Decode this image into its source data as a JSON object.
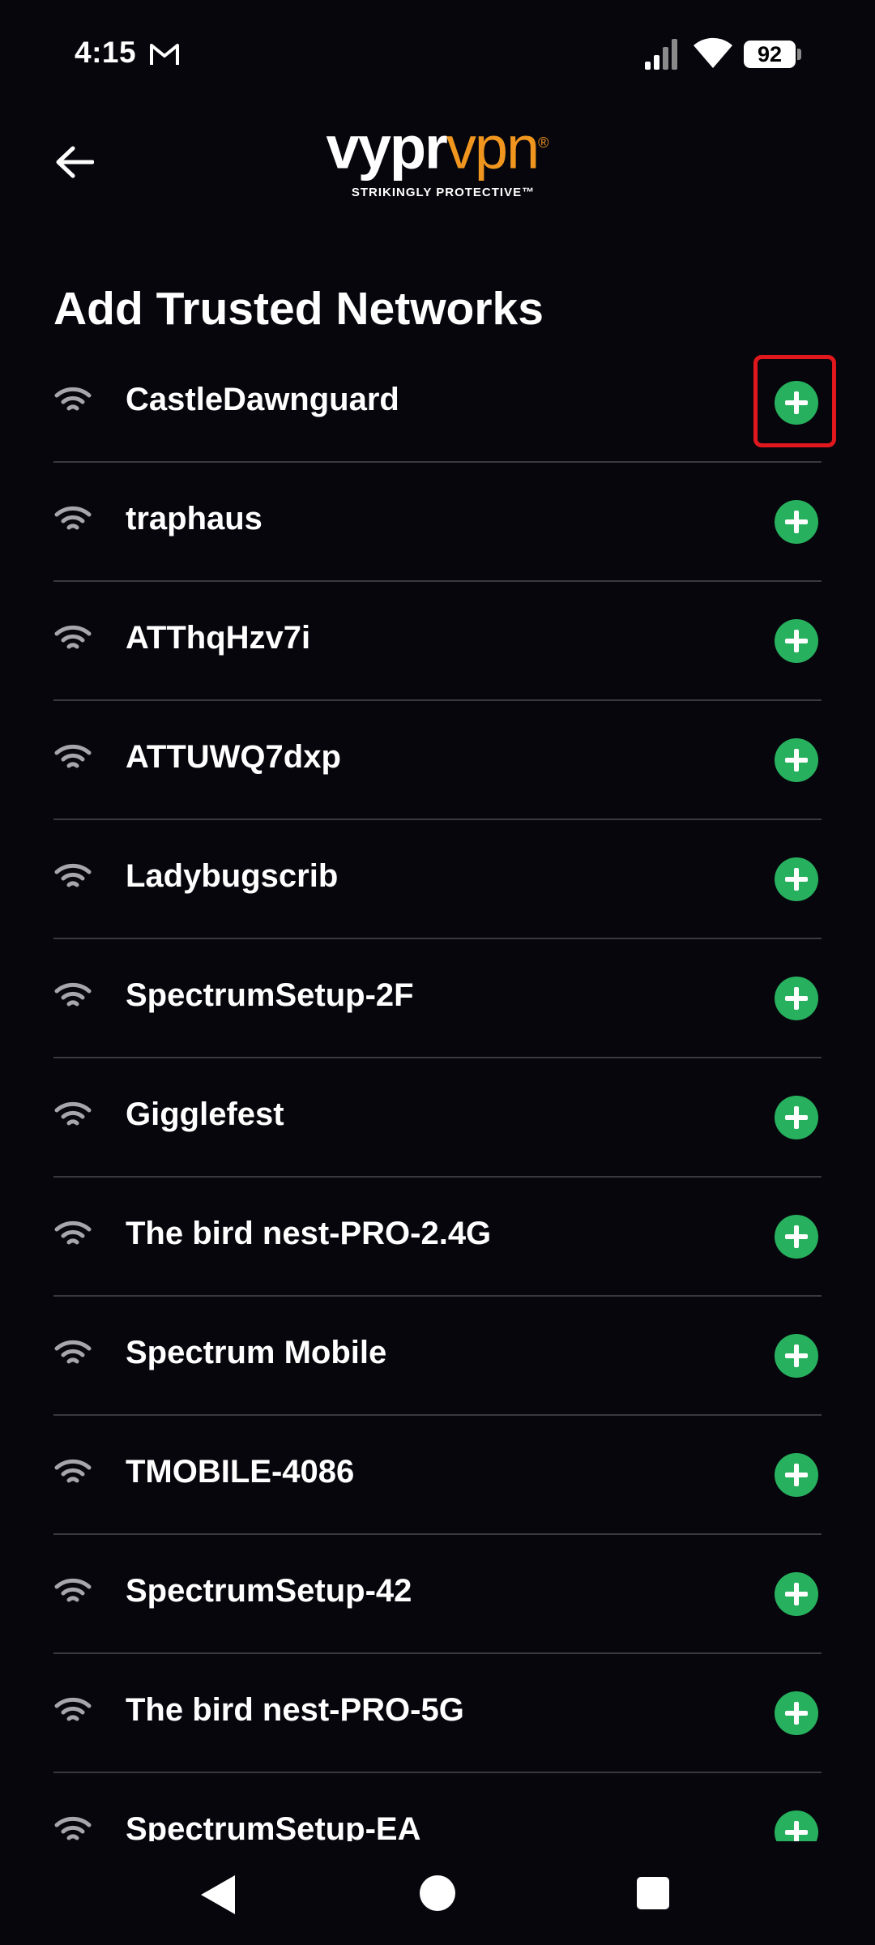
{
  "status_bar": {
    "time": "4:15",
    "battery": "92",
    "icons": [
      "gmail-icon",
      "signal-icon",
      "wifi-icon",
      "battery-icon"
    ]
  },
  "header": {
    "brand_primary": "vypr",
    "brand_secondary": "vpn",
    "brand_mark": "®",
    "tagline": "STRIKINGLY PROTECTIVE™",
    "brand_colors": {
      "primary": "#ffffff",
      "secondary": "#f0961e"
    }
  },
  "page": {
    "title": "Add Trusted Networks"
  },
  "networks": [
    {
      "name": "CastleDawnguard"
    },
    {
      "name": "traphaus"
    },
    {
      "name": "ATThqHzv7i"
    },
    {
      "name": "ATTUWQ7dxp"
    },
    {
      "name": "Ladybugscrib"
    },
    {
      "name": "SpectrumSetup-2F"
    },
    {
      "name": "Gigglefest"
    },
    {
      "name": "The bird nest-PRO-2.4G"
    },
    {
      "name": "Spectrum Mobile"
    },
    {
      "name": "TMOBILE-4086"
    },
    {
      "name": "SpectrumSetup-42"
    },
    {
      "name": "The bird nest-PRO-5G"
    },
    {
      "name": "SpectrumSetup-EA"
    }
  ],
  "colors": {
    "background": "#07060d",
    "add_button": "#27b05d",
    "highlight": "#e0181e",
    "divider": "#3a3940"
  }
}
